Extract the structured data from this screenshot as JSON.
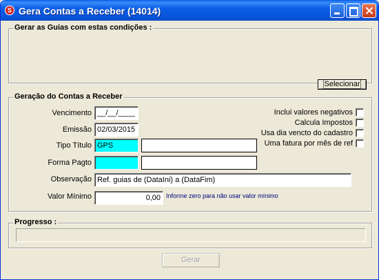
{
  "window": {
    "title": "Gera Contas a Receber (14014)",
    "app_icon": "S"
  },
  "groups": {
    "conditions": {
      "label": "Gerar as Guias com estas condições :"
    },
    "generation": {
      "label": "Geração do Contas a Receber"
    },
    "progress": {
      "label": "Progresso :"
    }
  },
  "buttons": {
    "selecionar": "Selecionar",
    "gerar": "Gerar"
  },
  "form": {
    "vencimento": {
      "label": "Vencimento",
      "value": "__/__/____"
    },
    "emissao": {
      "label": "Emissão",
      "value": "02/03/2015"
    },
    "tipo_titulo": {
      "label": "Tipo Título",
      "value": "GPS",
      "description": ""
    },
    "forma_pagto": {
      "label": "Forma Pagto",
      "value": "",
      "description": ""
    },
    "observacao": {
      "label": "Observação",
      "value": "Ref. guias de (DataIni) a (DataFim)"
    },
    "valor_minimo": {
      "label": "Valor Mínimo",
      "value": "0,00",
      "hint": "Informe zero para não usar valor mínimo"
    }
  },
  "options": [
    {
      "label": "Inclui valores negativos",
      "checked": false
    },
    {
      "label": "Calcula Impostos",
      "checked": false
    },
    {
      "label": "Usa dia vencto do cadastro",
      "checked": false
    },
    {
      "label": "Uma fatura por mês de ref",
      "checked": false
    }
  ],
  "progress": {
    "percent": 0
  },
  "colors": {
    "title_bar": "#0a5ee9",
    "window_bg": "#ece9d8",
    "highlight_field": "#00ffff",
    "hint_text": "#000080"
  }
}
